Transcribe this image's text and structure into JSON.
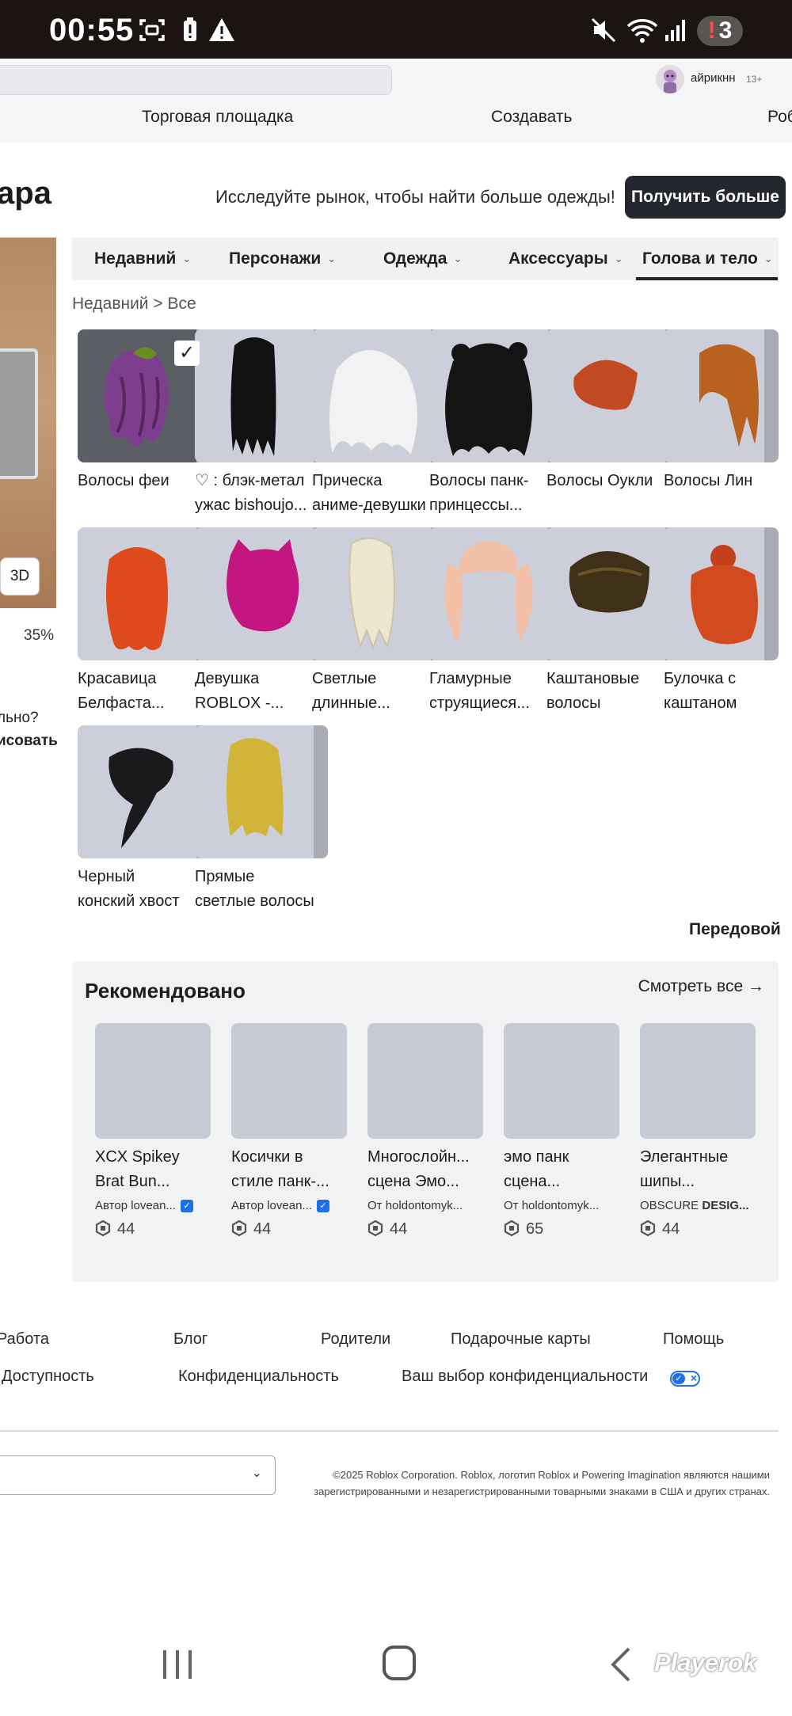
{
  "status_bar": {
    "time": "00:55",
    "notification_count": "3"
  },
  "header": {
    "username": "айрикнн",
    "age_badge": "13+",
    "nav": [
      "Торговая площадка",
      "Создавать",
      "Роб"
    ]
  },
  "page": {
    "title": "ара",
    "promo_text": "Исследуйте рынок, чтобы найти больше одежды!",
    "get_more_button": "Получить больше"
  },
  "preview": {
    "mode_button": "3D",
    "zoom": "35%",
    "side_text_1": "льно?",
    "side_text_2": "исовать"
  },
  "categories": {
    "tabs": [
      "Недавний",
      "Персонажи",
      "Одежда",
      "Аксессуары",
      "Голова и тело"
    ],
    "active_tab": "Голова и тело",
    "breadcrumb": {
      "parent": "Недавний",
      "separator": ">",
      "current": "Все"
    }
  },
  "items": [
    {
      "line1": "Волосы феи",
      "line2": ""
    },
    {
      "line1": "♡ : блэк-метал",
      "line2": "ужас bishoujo..."
    },
    {
      "line1": "Прическа",
      "line2": "аниме-девушки"
    },
    {
      "line1": "Волосы панк-",
      "line2": "принцессы..."
    },
    {
      "line1": "Волосы Оукли",
      "line2": ""
    },
    {
      "line1": "Волосы Лин",
      "line2": ""
    },
    {
      "line1": "Красавица",
      "line2": "Белфаста..."
    },
    {
      "line1": "Девушка",
      "line2": "ROBLOX -..."
    },
    {
      "line1": "Светлые",
      "line2": "длинные..."
    },
    {
      "line1": "Гламурные",
      "line2": "струящиеся..."
    },
    {
      "line1": "Каштановые",
      "line2": "волосы"
    },
    {
      "line1": "Булочка с",
      "line2": "каштаном"
    },
    {
      "line1": "Черный",
      "line2": "конский хвост"
    },
    {
      "line1": "Прямые",
      "line2": "светлые волосы"
    }
  ],
  "advanced_link": "Передовой",
  "recommended": {
    "title": "Рекомендовано",
    "see_all": "Смотреть все →",
    "items": [
      {
        "line1": "XCX Spikey",
        "line2": "Brat Bun...",
        "author_prefix": "Автор",
        "author": "lovean...",
        "verified": true,
        "price": "44"
      },
      {
        "line1": "Косички в",
        "line2": "стиле панк-...",
        "author_prefix": "Автор",
        "author": "lovean...",
        "verified": true,
        "price": "44"
      },
      {
        "line1": "Многослойн...",
        "line2": "сцена Эмо...",
        "author_prefix": "От",
        "author": "holdontomyk...",
        "verified": false,
        "price": "44"
      },
      {
        "line1": "эмо панк",
        "line2": "сцена...",
        "author_prefix": "От",
        "author": "holdontomyk...",
        "verified": false,
        "price": "65"
      },
      {
        "line1": "Элегантные",
        "line2": "шипы...",
        "author_prefix": "OBSCURE",
        "author": "DESIG...",
        "verified": false,
        "price": "44"
      }
    ]
  },
  "footer": {
    "row1": [
      "Работа",
      "Блог",
      "Родители",
      "Подарочные карты",
      "Помощь"
    ],
    "row2": [
      "Доступность",
      "Конфиденциальность",
      "Ваш выбор конфиденциальности"
    ],
    "copyright_line1": "©2025 Roblox Corporation. Roblox, логотип Roblox и Powering Imagination являются нашими",
    "copyright_line2": "зарегистрированными и незарегистрированными товарными знаками в США и других странах."
  },
  "watermark": "Playerok",
  "colors": {
    "accent": "#1f6feb",
    "dark_button": "#24272d",
    "status_bar": "#1b1413",
    "thumb_bg": "#ccced9"
  }
}
